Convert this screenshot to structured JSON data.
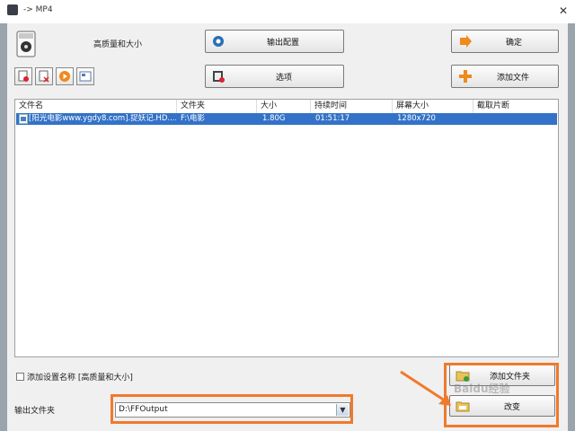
{
  "window": {
    "title": "-> MP4",
    "close": "✕"
  },
  "preset": {
    "label": "高质量和大小"
  },
  "toolbar": {
    "output_config": "输出配置",
    "options": "选项",
    "ok": "确定",
    "add_file": "添加文件",
    "add_folder": "添加文件夹",
    "change": "改变"
  },
  "list": {
    "columns": [
      "文件名",
      "文件夹",
      "大小",
      "持续时间",
      "屏幕大小",
      "截取片断"
    ],
    "rows": [
      [
        "[阳光电影www.ygdy8.com].捉妖记.HD....",
        "F:\\电影",
        "1.80G",
        "01:51:17",
        "1280x720",
        ""
      ]
    ]
  },
  "add_setting_name": {
    "label": "添加设置名称 [高质量和大小]",
    "checked": false
  },
  "output_folder": {
    "label": "输出文件夹",
    "value": "D:\\FFOutput"
  },
  "colors": {
    "accent": "#3372c8",
    "highlight": "#f07a2c"
  },
  "watermark": "Baidu经验"
}
